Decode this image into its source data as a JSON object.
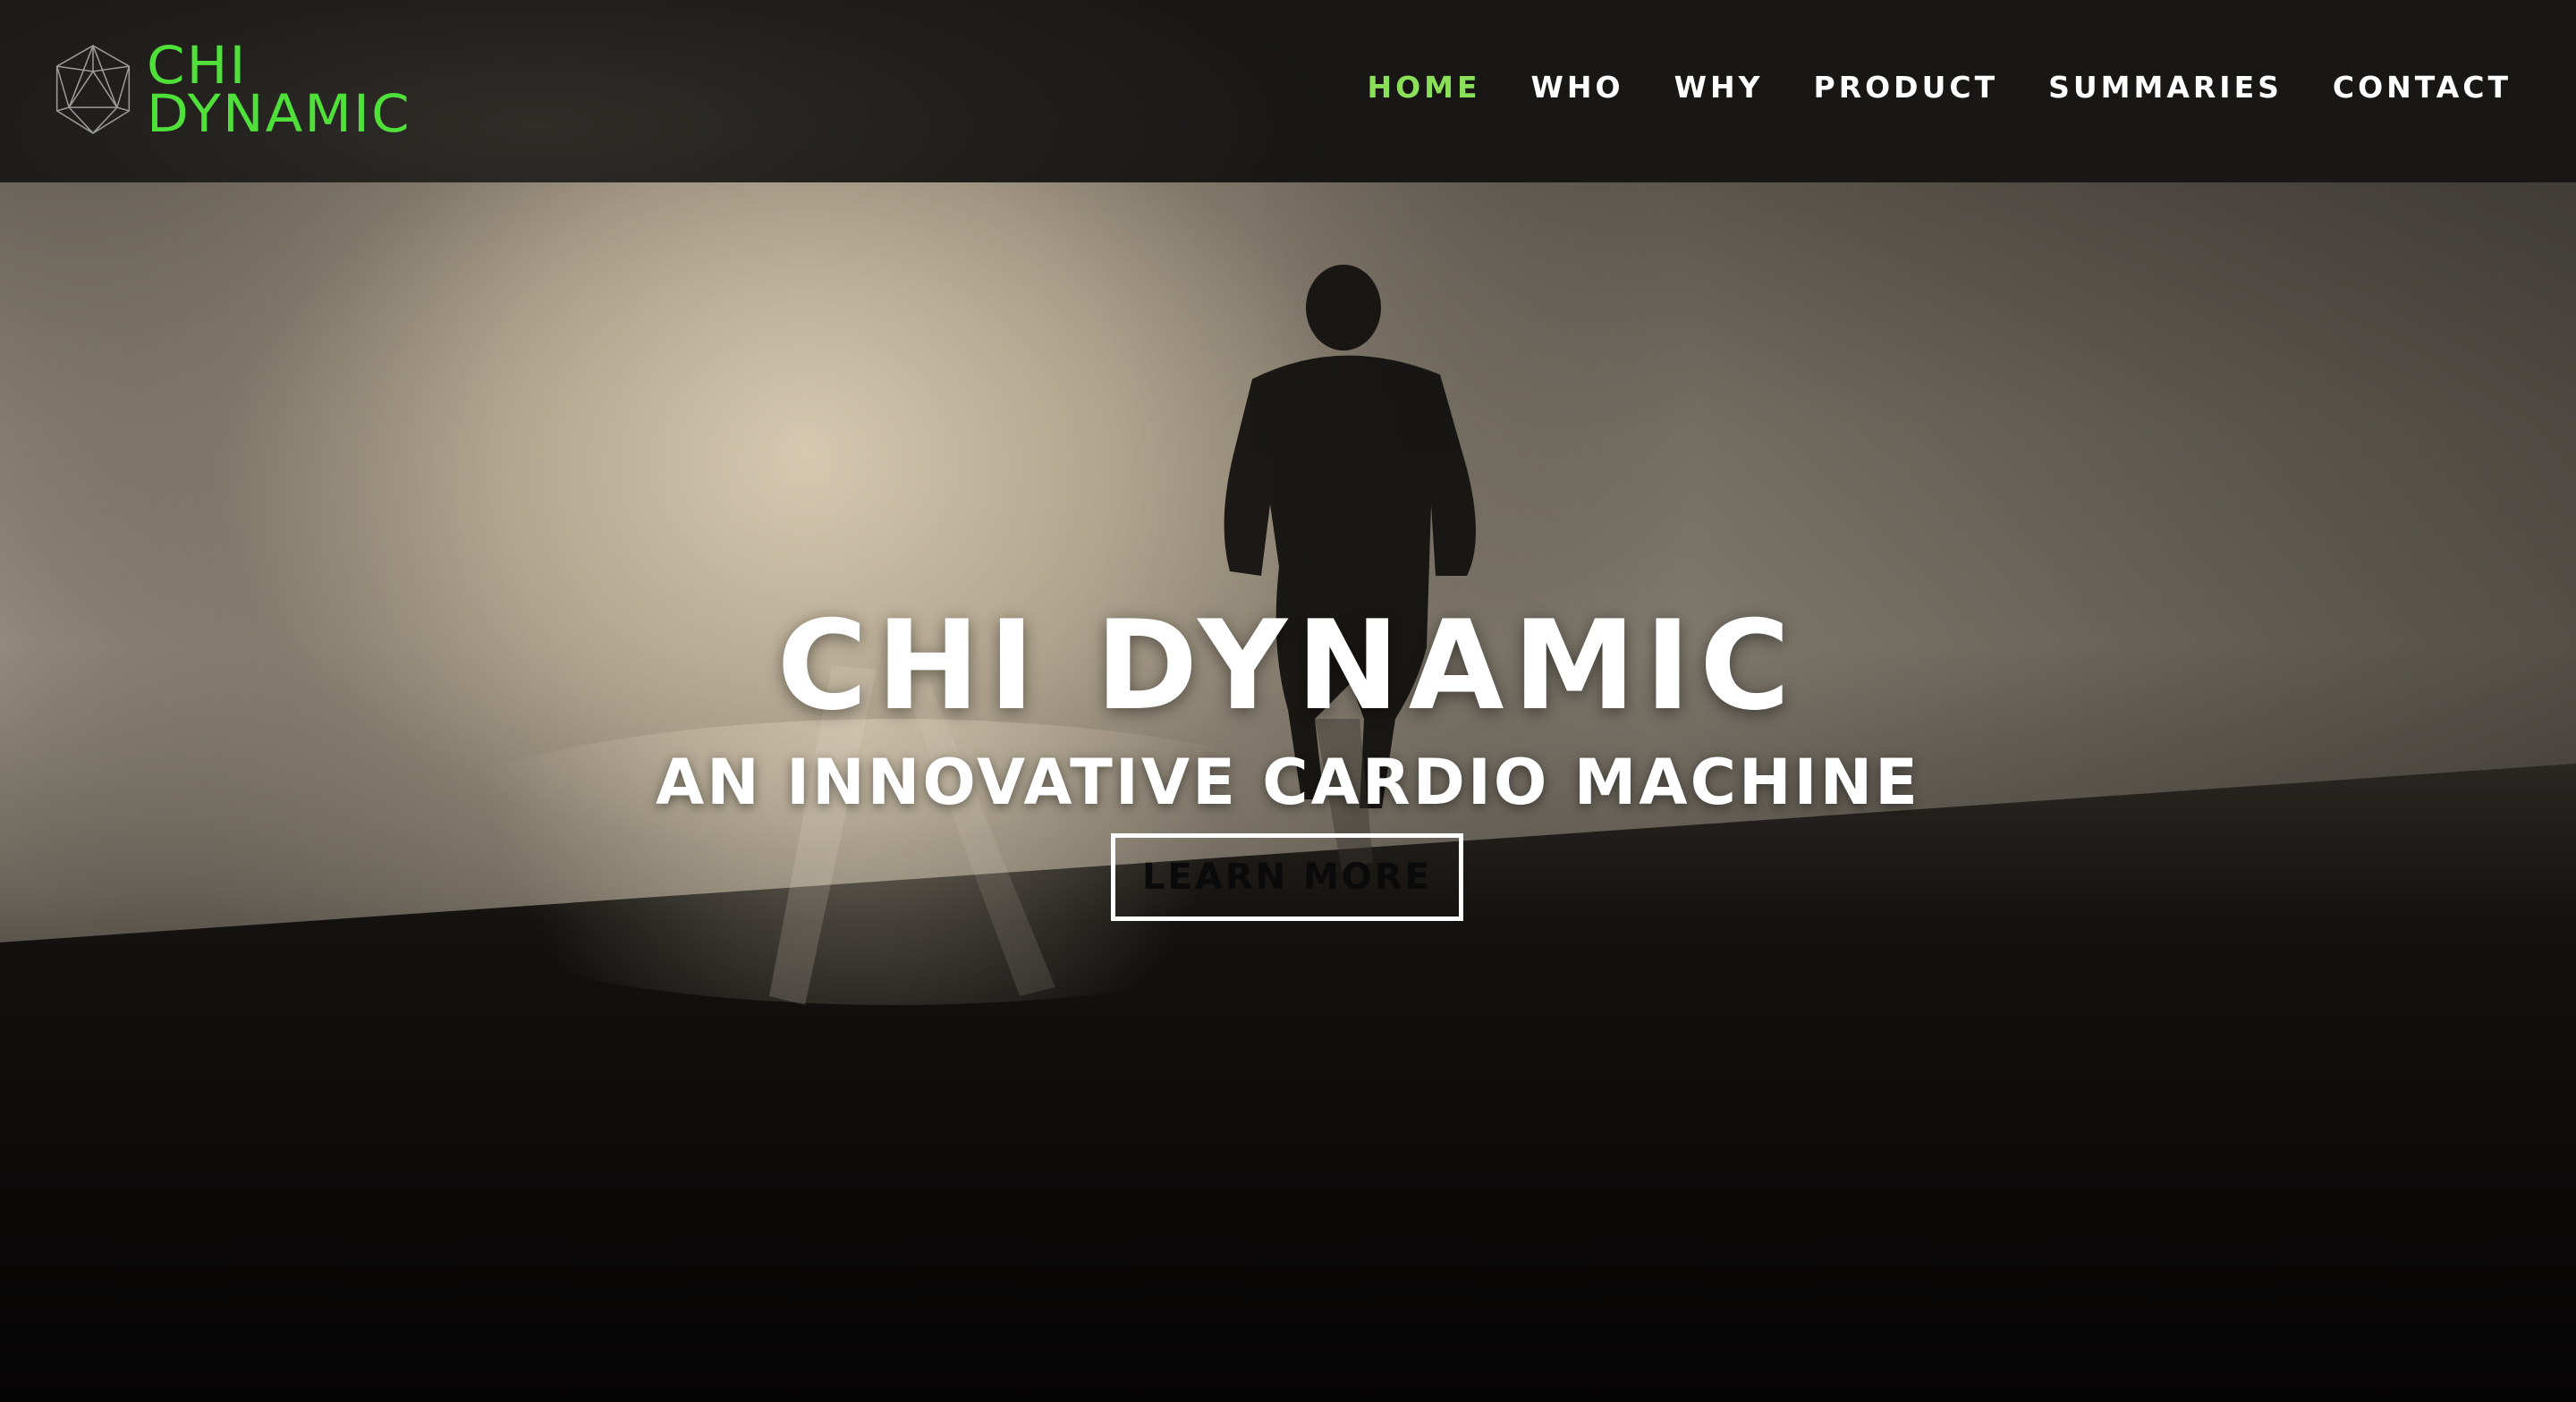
{
  "brand": {
    "logo_line1": "CHI",
    "logo_line2": "DYNAMIC",
    "logo_icon": "icosahedron-icon",
    "accent_color": "#4fe03a"
  },
  "nav": {
    "items": [
      {
        "label": "HOME",
        "active": true
      },
      {
        "label": "WHO",
        "active": false
      },
      {
        "label": "WHY",
        "active": false
      },
      {
        "label": "PRODUCT",
        "active": false
      },
      {
        "label": "SUMMARIES",
        "active": false
      },
      {
        "label": "CONTACT",
        "active": false
      }
    ],
    "active_color": "#8be05a",
    "text_color": "#ffffff"
  },
  "hero": {
    "title": "CHI DYNAMIC",
    "subtitle": "AN INNOVATIVE CARDIO MACHINE",
    "button_label": "LEARN MORE",
    "background_image": "runner-silhouette-uphill-sepia"
  }
}
